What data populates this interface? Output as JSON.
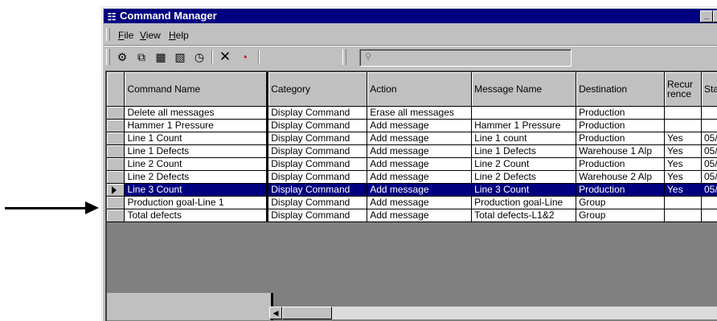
{
  "window": {
    "title": "Command Manager",
    "app_icon": "app-icon"
  },
  "menu": [
    {
      "label": "File",
      "accel": "F",
      "rest": "ile"
    },
    {
      "label": "View",
      "accel": "V",
      "rest": "iew"
    },
    {
      "label": "Help",
      "accel": "H",
      "rest": "elp"
    }
  ],
  "toolbar": {
    "icons": [
      "new-command-icon",
      "copy-command-icon",
      "properties-icon",
      "edit-properties-icon",
      "schedule-icon",
      "delete-icon",
      "run-icon",
      "find-icon"
    ],
    "find_value": ""
  },
  "grid": {
    "columns": [
      "Command Name",
      "Category",
      "Action",
      "Message Name",
      "Destination",
      "Recur rence",
      "Sta"
    ],
    "rows": [
      [
        "Delete all messages",
        "Display Command",
        "Erase all messages",
        "",
        "Production",
        "",
        ""
      ],
      [
        "Hammer 1 Pressure",
        "Display Command",
        "Add message",
        "Hammer 1 Pressure",
        "Production",
        "",
        ""
      ],
      [
        "Line 1 Count",
        "Display Command",
        "Add message",
        "Line 1 count",
        "Production",
        "Yes",
        "05/"
      ],
      [
        "Line 1 Defects",
        "Display Command",
        "Add message",
        "Line 1 Defects",
        "Warehouse 1 Alp",
        "Yes",
        "05/"
      ],
      [
        "Line 2 Count",
        "Display Command",
        "Add message",
        "Line 2 Count",
        "Production",
        "Yes",
        "05/"
      ],
      [
        "Line 2 Defects",
        "Display Command",
        "Add message",
        "Line 2 Defects",
        "Warehouse 2 Alp",
        "Yes",
        "05/"
      ],
      [
        "Line 3 Count",
        "Display Command",
        "Add message",
        "Line 3 Count",
        "Production",
        "Yes",
        "05/"
      ],
      [
        "Production goal-Line 1",
        "Display Command",
        "Add message",
        "Production goal-Line",
        "Group",
        "",
        ""
      ],
      [
        "Total defects",
        "Display Command",
        "Add message",
        "Total defects-L1&2",
        "Group",
        "",
        ""
      ]
    ],
    "selected_row": 6
  },
  "colors": {
    "title_bar": "#000080",
    "selection": "#000080",
    "chrome": "#c0c0c0"
  }
}
